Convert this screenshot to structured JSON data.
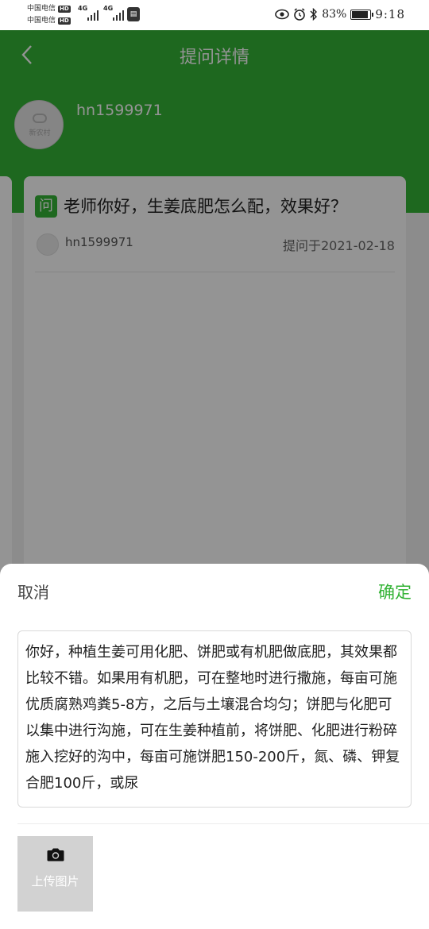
{
  "status_bar": {
    "carrier_1": "中国电信",
    "carrier_2": "中国电信",
    "hd_badge": "HD",
    "network_1": "4G",
    "network_2": "4G",
    "battery_percent": "83%",
    "battery_level": 0.83,
    "time": "9:18"
  },
  "header": {
    "title": "提问详情",
    "username": "hn1599971",
    "avatar_text": "新农村"
  },
  "question": {
    "badge": "问",
    "text": "老师你好，生姜底肥怎么配，效果好？",
    "asker": "hn1599971",
    "asked_at": "提问于2021-02-18"
  },
  "answer_sheet": {
    "cancel_label": "取消",
    "confirm_label": "确定",
    "answer_text": "你好，种植生姜可用化肥、饼肥或有机肥做底肥，其效果都比较不错。如果用有机肥，可在整地时进行撒施，每亩可施优质腐熟鸡粪5-8方，之后与土壤混合均匀；饼肥与化肥可以集中进行沟施，可在生姜种植前，将饼肥、化肥进行粉碎施入挖好的沟中，每亩可施饼肥150-200斤，氮、磷、钾复合肥100斤，或尿",
    "upload_label": "上传图片"
  },
  "colors": {
    "brand_green": "#34b336",
    "overlay": "rgba(0,0,0,0.42)"
  },
  "icons": {
    "back": "chevron-left-icon",
    "camera": "camera-icon",
    "eye": "eye-icon",
    "alarm": "alarm-icon",
    "bluetooth": "bluetooth-icon",
    "battery": "battery-icon"
  }
}
